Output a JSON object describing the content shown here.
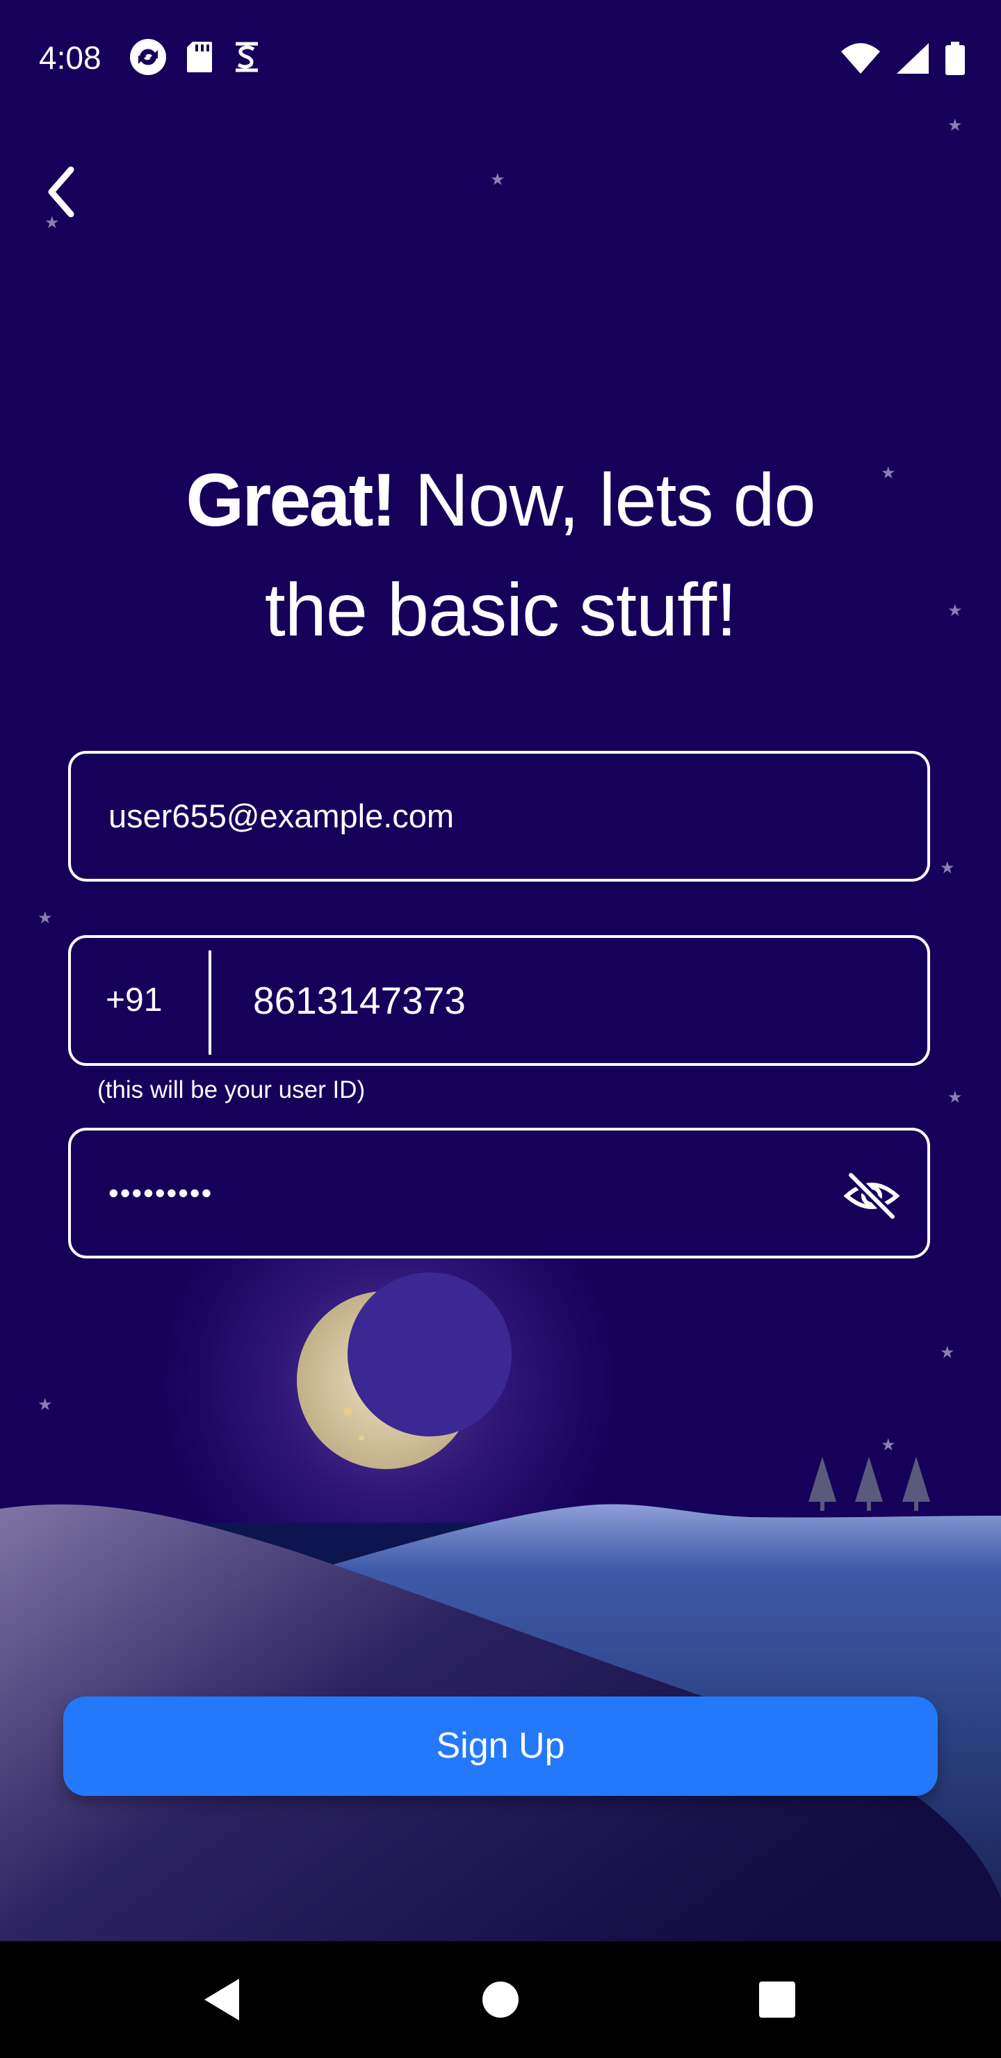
{
  "status_bar": {
    "time": "4:08"
  },
  "headline": {
    "bold": "Great!",
    "rest_line1": " Now, lets do",
    "line2": "the basic stuff!"
  },
  "form": {
    "email_value": "user655@example.com",
    "country_code": "+91",
    "phone_value": "8613147373",
    "phone_hint": "(this will be your user ID)",
    "password_masked": "•••••••••"
  },
  "signup_button": {
    "label": "Sign Up"
  },
  "colors": {
    "background": "#15005a",
    "button": "#2379fa"
  },
  "icons": [
    "back-arrow-icon",
    "eye-off-icon",
    "moon-icon",
    "nav-back-icon",
    "nav-home-icon",
    "nav-recents-icon"
  ]
}
